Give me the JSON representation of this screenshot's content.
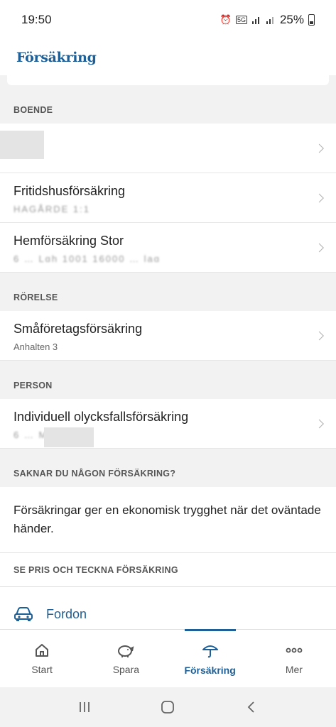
{
  "status_bar": {
    "time": "19:50",
    "network": "5G",
    "battery": "25%"
  },
  "header": {
    "title": "Försäkring"
  },
  "sections": [
    {
      "heading": "BOENDE",
      "items": [
        {
          "title": "",
          "subtitle": ""
        },
        {
          "title": "Fritidshusförsäkring",
          "subtitle": "HAGÅRDE 1:1"
        },
        {
          "title": "Hemförsäkring Stor",
          "subtitle": "6  … Lgh 1001 16000 … lag"
        }
      ]
    },
    {
      "heading": "RÖRELSE",
      "items": [
        {
          "title": "Småföretagsförsäkring",
          "subtitle": "Anhalten 3"
        }
      ]
    },
    {
      "heading": "PERSON",
      "items": [
        {
          "title": "Individuell olycksfallsförsäkring",
          "subtitle": "6  … Mikael"
        }
      ]
    }
  ],
  "missing": {
    "heading": "SAKNAR DU NÅGON FÖRSÄKRING?",
    "text": "Försäkringar ger en ekonomisk trygghet när det oväntade händer.",
    "subheading": "SE PRIS OCH TECKNA FÖRSÄKRING",
    "fordon_label": "Fordon"
  },
  "bottom_nav": [
    {
      "label": "Start",
      "icon": "home-icon"
    },
    {
      "label": "Spara",
      "icon": "piggy-bank-icon"
    },
    {
      "label": "Försäkring",
      "icon": "umbrella-icon",
      "active": true
    },
    {
      "label": "Mer",
      "icon": "more-dots-icon"
    }
  ],
  "colors": {
    "brand": "#1d5f96",
    "background": "#f2f2f2"
  }
}
